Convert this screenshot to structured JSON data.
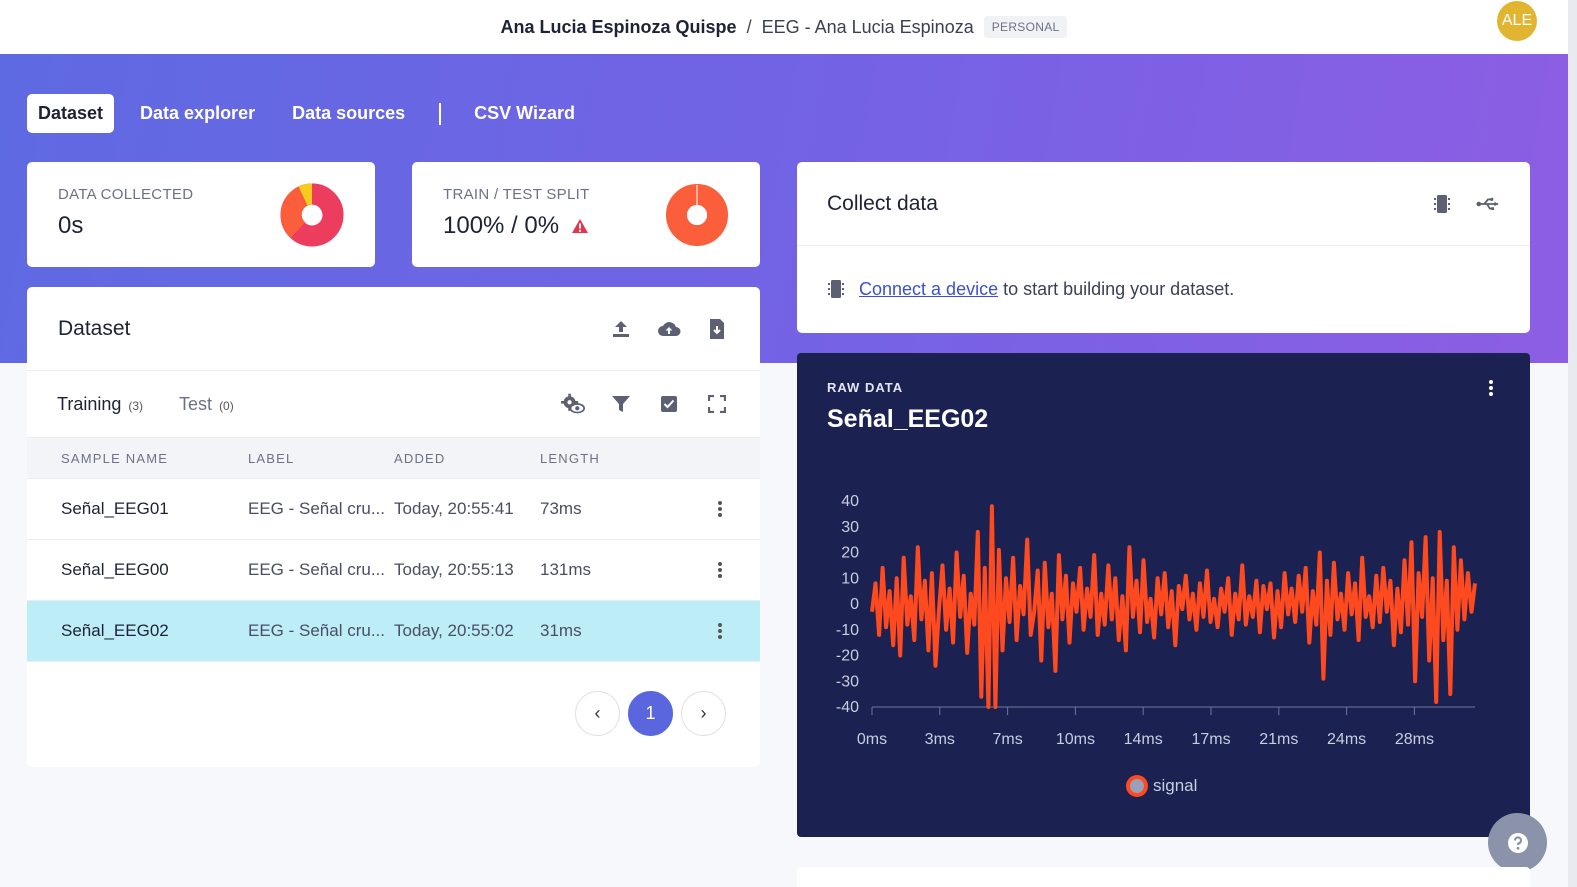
{
  "header": {
    "owner": "Ana Lucia Espinoza Quispe",
    "separator": "/",
    "project": "EEG - Ana Lucia Espinoza",
    "badge": "PERSONAL",
    "avatar_initials": "ALE"
  },
  "tabs": [
    {
      "label": "Dataset",
      "active": true
    },
    {
      "label": "Data explorer"
    },
    {
      "label": "Data sources"
    },
    {
      "label": "CSV Wizard"
    }
  ],
  "stats": {
    "collected": {
      "label": "DATA COLLECTED",
      "value": "0s"
    },
    "split": {
      "label": "TRAIN / TEST SPLIT",
      "value": "100% / 0%",
      "train_fraction": 1.0
    }
  },
  "dataset": {
    "title": "Dataset",
    "tabs": [
      {
        "label": "Training",
        "count": "(3)"
      },
      {
        "label": "Test",
        "count": "(0)"
      }
    ],
    "columns": [
      "SAMPLE NAME",
      "LABEL",
      "ADDED",
      "LENGTH"
    ],
    "rows": [
      {
        "name": "Señal_EEG01",
        "label": "EEG - Señal cru...",
        "added": "Today, 20:55:41",
        "length": "73ms"
      },
      {
        "name": "Señal_EEG00",
        "label": "EEG - Señal cru...",
        "added": "Today, 20:55:13",
        "length": "131ms"
      },
      {
        "name": "Señal_EEG02",
        "label": "EEG - Señal cru...",
        "added": "Today, 20:55:02",
        "length": "31ms",
        "selected": true
      }
    ],
    "page": "1",
    "prev": "‹",
    "next": "›"
  },
  "collect": {
    "title": "Collect data",
    "link": "Connect a device",
    "text": "to start building your dataset."
  },
  "raw": {
    "label": "RAW DATA",
    "title": "Señal_EEG02"
  },
  "colors": {
    "accent": "#5a66de",
    "signal": "#ff4a1f",
    "chart_bg": "#1b2150",
    "avatar": "#e2b531",
    "selected_row": "#bdeef8"
  },
  "chart_data": {
    "type": "line",
    "ylim": [
      -40,
      40
    ],
    "yticks": [
      40,
      30,
      20,
      10,
      0,
      -10,
      -20,
      -30,
      -40
    ],
    "xticks": [
      "0ms",
      "3ms",
      "7ms",
      "10ms",
      "14ms",
      "17ms",
      "21ms",
      "24ms",
      "28ms"
    ],
    "legend": "signal",
    "legend_position": "bottom",
    "series": [
      {
        "name": "signal",
        "values": [
          -3,
          8,
          -12,
          14,
          -9,
          5,
          -16,
          10,
          -20,
          18,
          -8,
          3,
          -14,
          22,
          -6,
          9,
          -18,
          12,
          -24,
          -2,
          15,
          -10,
          6,
          -15,
          20,
          -5,
          11,
          -19,
          4,
          -8,
          28,
          -36,
          14,
          -40,
          38,
          -44,
          21,
          -18,
          10,
          -7,
          18,
          -14,
          7,
          -4,
          25,
          -12,
          -3,
          13,
          -22,
          16,
          -9,
          4,
          -26,
          19,
          -6,
          11,
          -15,
          8,
          -3,
          14,
          -10,
          6,
          -5,
          19,
          -12,
          4,
          -8,
          15,
          -6,
          10,
          -14,
          3,
          -18,
          22,
          -5,
          9,
          -11,
          17,
          -7,
          2,
          -13,
          10,
          -4,
          12,
          -9,
          5,
          -16,
          7,
          -2,
          11,
          -6,
          4,
          -10,
          8,
          -5,
          13,
          -7,
          2,
          -9,
          6,
          -3,
          10,
          -12,
          4,
          -6,
          15,
          -8,
          3,
          -5,
          9,
          -11,
          7,
          -2,
          8,
          -13,
          5,
          -9,
          12,
          -4,
          6,
          -7,
          11,
          -3,
          14,
          -15,
          5,
          -8,
          20,
          -29,
          9,
          -12,
          16,
          -6,
          4,
          -10,
          12,
          -4,
          8,
          -14,
          18,
          -5,
          3,
          -9,
          11,
          -7,
          14,
          -3,
          9,
          -16,
          6,
          -11,
          17,
          -8,
          24,
          -30,
          12,
          -5,
          26,
          -22,
          10,
          -38,
          28,
          -14,
          9,
          -35,
          22,
          -10,
          17,
          -6,
          12,
          -3,
          8
        ]
      }
    ]
  }
}
